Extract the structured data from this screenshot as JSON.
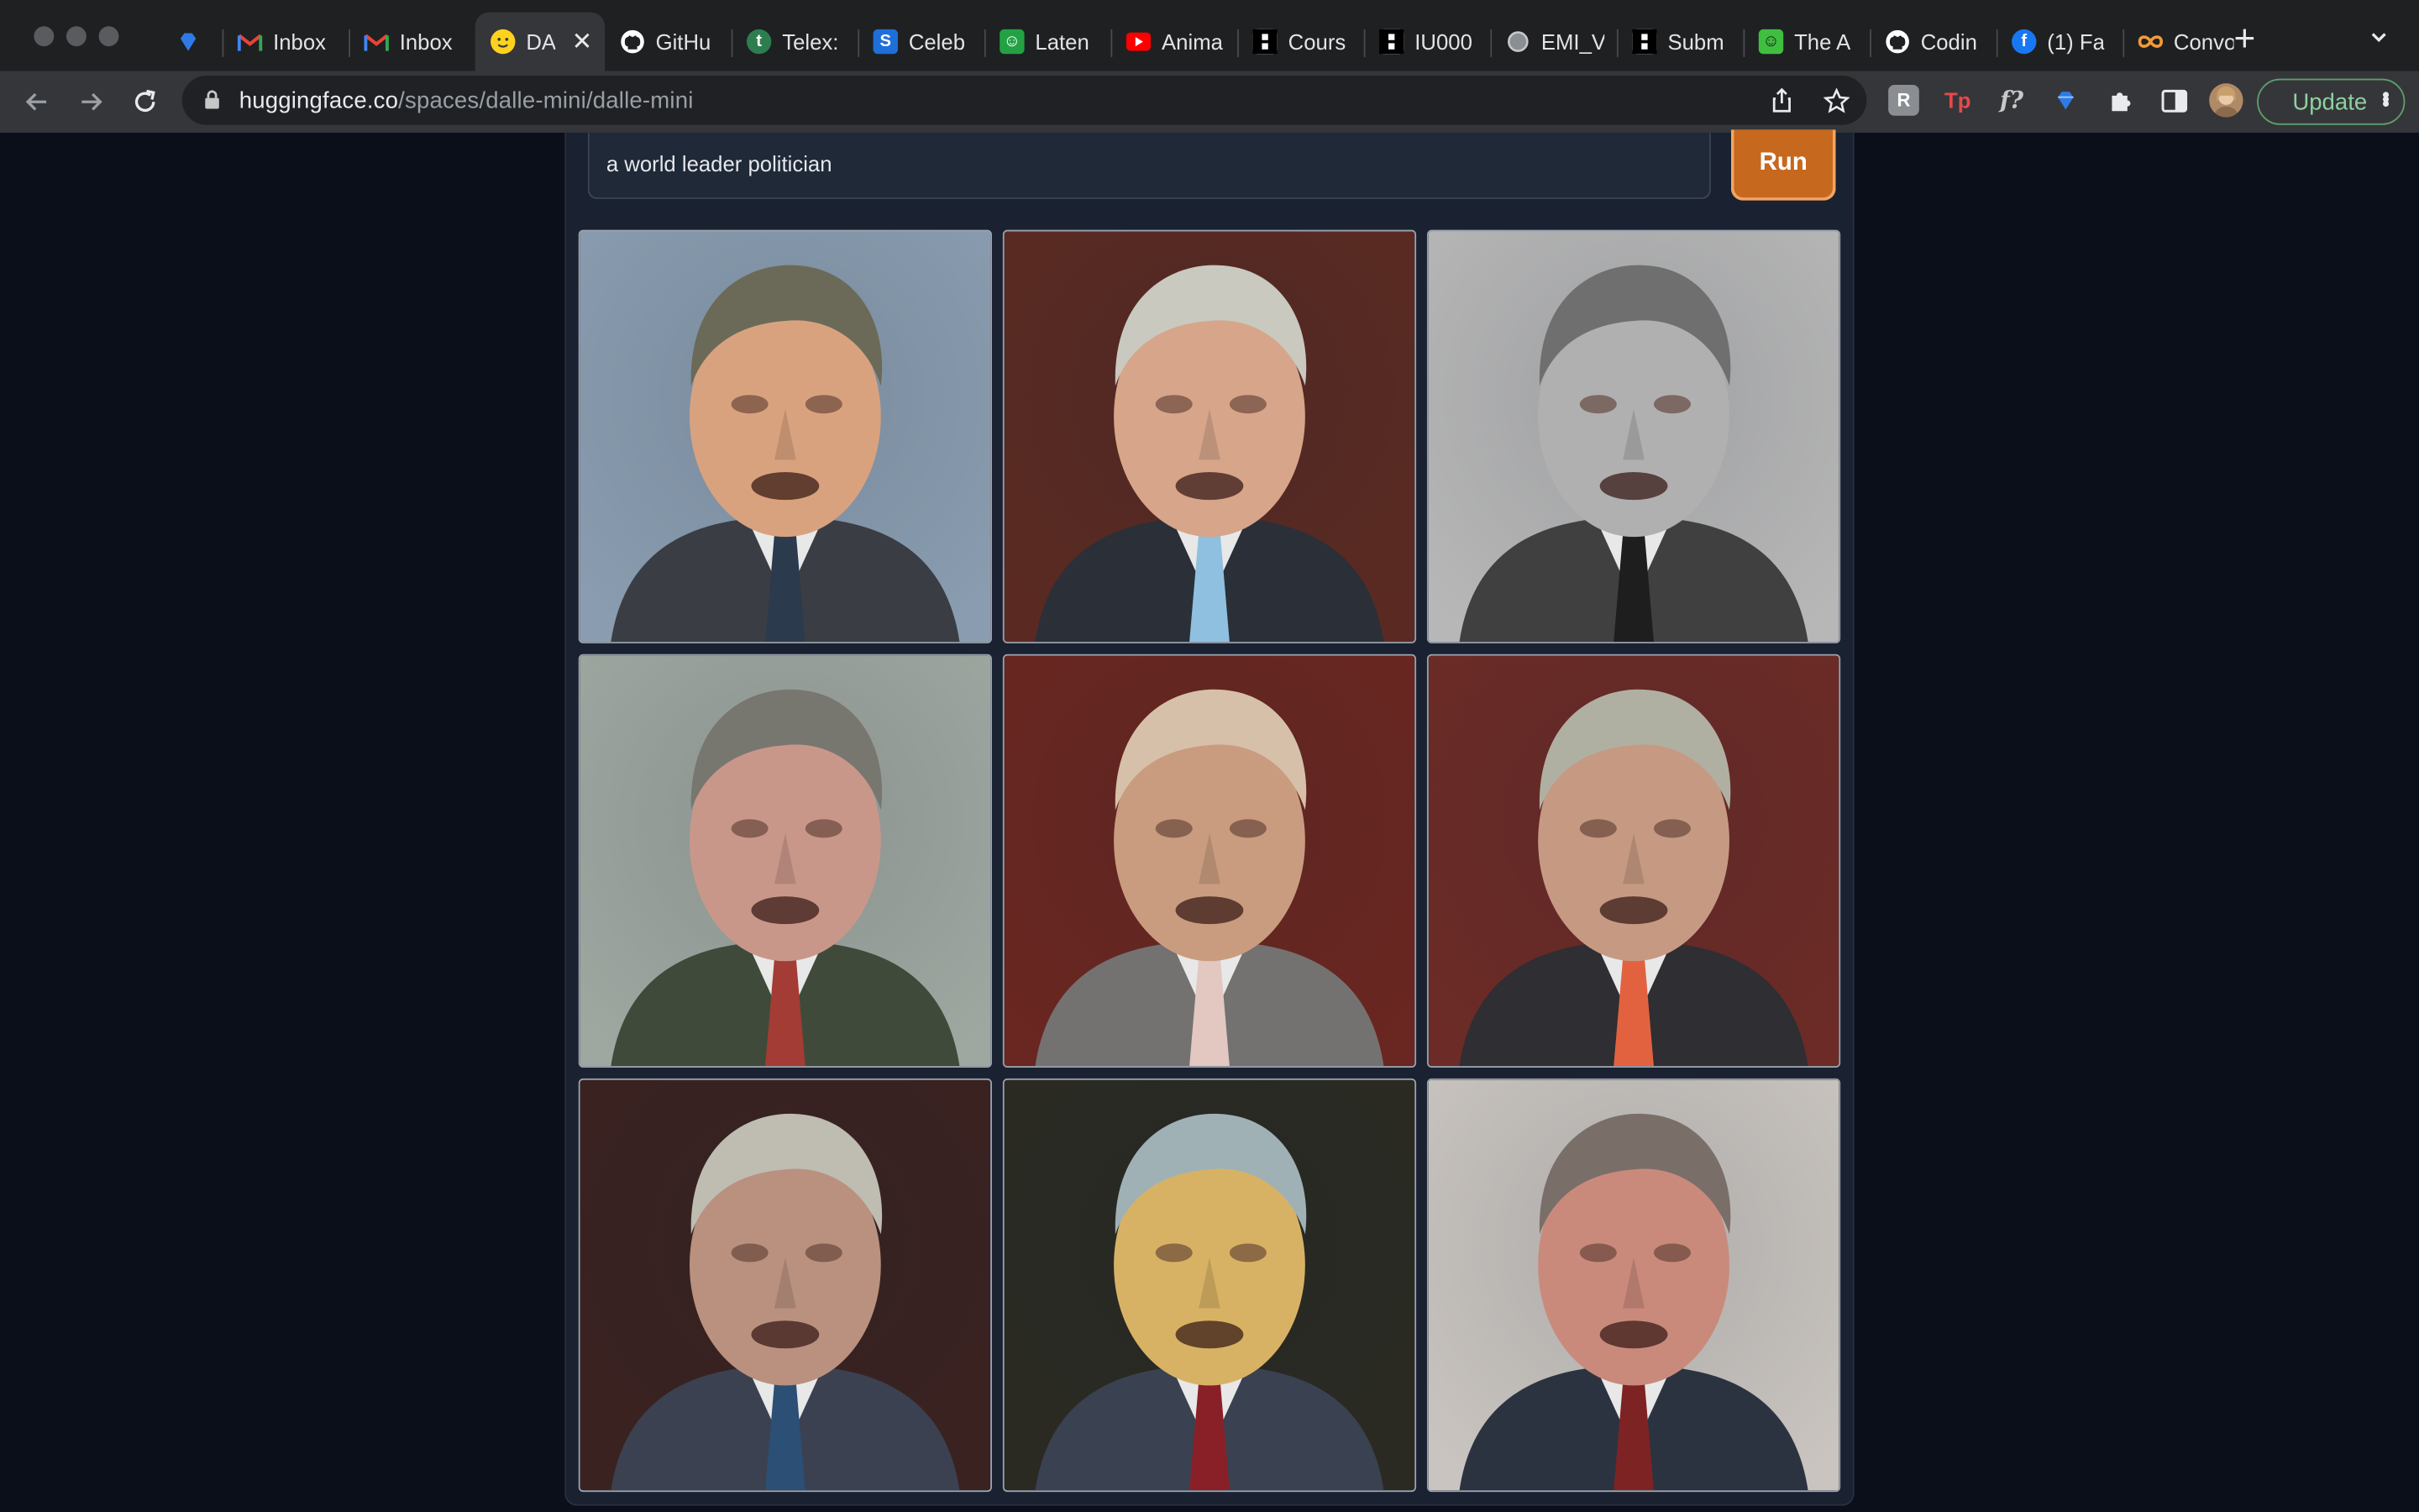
{
  "browser": {
    "tabs": [
      {
        "label": "",
        "icon": "diamond-icon",
        "color": "#2f7be6"
      },
      {
        "label": "Inbox",
        "icon": "gmail-icon",
        "color": "#ea4335"
      },
      {
        "label": "Inbox",
        "icon": "gmail-icon",
        "color": "#ea4335"
      },
      {
        "label": "DA",
        "icon": "huggingface-icon",
        "color": "#ffd21e",
        "active": true
      },
      {
        "label": "GitHu",
        "icon": "github-icon",
        "color": "#ffffff"
      },
      {
        "label": "Telex:",
        "icon": "telex-icon",
        "color": "#2e7d4f"
      },
      {
        "label": "Celeb",
        "icon": "celeb-icon",
        "color": "#1e6fd9"
      },
      {
        "label": "Laten",
        "icon": "latent-icon",
        "color": "#23a244"
      },
      {
        "label": "Anima",
        "icon": "youtube-icon",
        "color": "#ff0000"
      },
      {
        "label": "Cours",
        "icon": "courses-icon",
        "color": "#111111"
      },
      {
        "label": "IU000",
        "icon": "iu-icon",
        "color": "#111111"
      },
      {
        "label": "EMI_V",
        "icon": "globe-icon",
        "color": "#8a8f96"
      },
      {
        "label": "Subm",
        "icon": "submit-icon",
        "color": "#111111"
      },
      {
        "label": "The A",
        "icon": "the-a-icon",
        "color": "#3fbf3f"
      },
      {
        "label": "Codin",
        "icon": "github-icon",
        "color": "#ffffff"
      },
      {
        "label": "(1) Fa",
        "icon": "facebook-icon",
        "color": "#1877f2"
      },
      {
        "label": "Convo",
        "icon": "infinity-icon",
        "color": "#f29a38"
      }
    ],
    "url_host": "huggingface.co",
    "url_path": "/spaces/dalle-mini/dalle-mini",
    "update_label": "Update",
    "accent": "#8fd19e"
  },
  "app": {
    "prompt_value": "a world leader politician",
    "run_label": "Run",
    "run_color": "#c7681f",
    "background": "#0b0f19",
    "panel": "#1a2130",
    "images": [
      {
        "bg": "#8a9db0",
        "skin": "#d9a27e",
        "hair": "#6b6a58",
        "suit": "#3a3e44",
        "tie": "#2c3a4d"
      },
      {
        "bg": "#5a2a22",
        "skin": "#d7a58a",
        "hair": "#c9c9c0",
        "suit": "#2b2f38",
        "tie": "#8fc0e0"
      },
      {
        "bg": "#b7b7b7",
        "skin": "#b0b0b0",
        "hair": "#6f6f6f",
        "suit": "#404040",
        "tie": "#1e1e1e"
      },
      {
        "bg": "#9fa7a1",
        "skin": "#c9978a",
        "hair": "#777770",
        "suit": "#3f4a3a",
        "tie": "#a33c34"
      },
      {
        "bg": "#6a2620",
        "skin": "#c99c7f",
        "hair": "#d7c0a9",
        "suit": "#747171",
        "tie": "#e2c8c0"
      },
      {
        "bg": "#6c2b26",
        "skin": "#c69a82",
        "hair": "#b0b0a2",
        "suit": "#2e2e33",
        "tie": "#e2623f"
      },
      {
        "bg": "#3a2220",
        "skin": "#b9917e",
        "hair": "#bfbcb2",
        "suit": "#3b4150",
        "tie": "#2b4f75"
      },
      {
        "bg": "#2a2a22",
        "skin": "#d8b264",
        "hair": "#9fb1b5",
        "suit": "#3a4150",
        "tie": "#8a2027"
      },
      {
        "bg": "#c9c4bf",
        "skin": "#c98a7c",
        "hair": "#7a6e69",
        "suit": "#2c3340",
        "tie": "#7e2323"
      }
    ]
  }
}
